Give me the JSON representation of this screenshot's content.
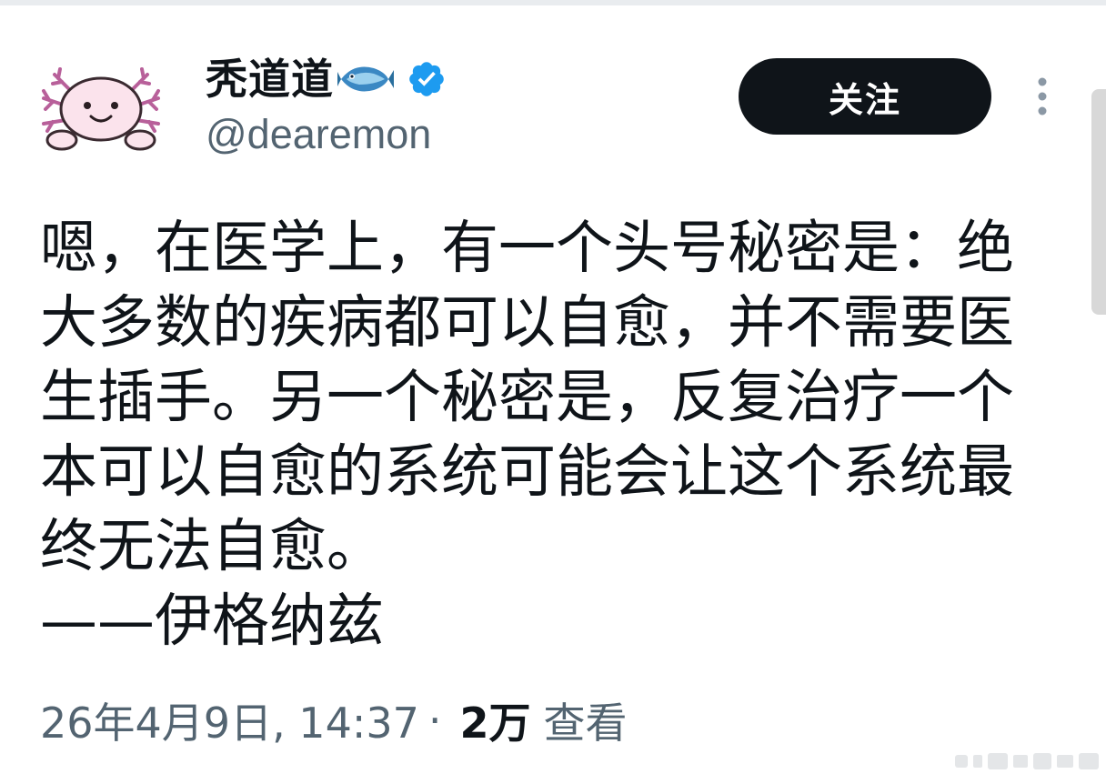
{
  "user": {
    "display_name": "秃道道",
    "name_emoji_icon": "fish-emoji-icon",
    "verified_icon": "verified-badge-icon",
    "handle": "@dearemon",
    "avatar_icon": "axolotl-avatar"
  },
  "follow_button": {
    "label": "关注"
  },
  "more_menu_icon": "more-vertical-icon",
  "tweet": {
    "lines": [
      "嗯，在医学上，有一个头号秘密是：绝",
      "大多数的疾病都可以自愈，并不需要医",
      "生插手。另一个秘密是，反复治疗一个",
      "本可以自愈的系统可能会让这个系统最",
      "终无法自愈。",
      "——伊格纳兹"
    ]
  },
  "meta": {
    "timestamp": "26年4月9日, 14:37",
    "separator": "·",
    "views_count": "2万",
    "views_label": "查看"
  },
  "colors": {
    "text_primary": "#0f1419",
    "text_secondary": "#536471",
    "verified_blue": "#1d9bf0",
    "button_bg": "#0f1419"
  }
}
